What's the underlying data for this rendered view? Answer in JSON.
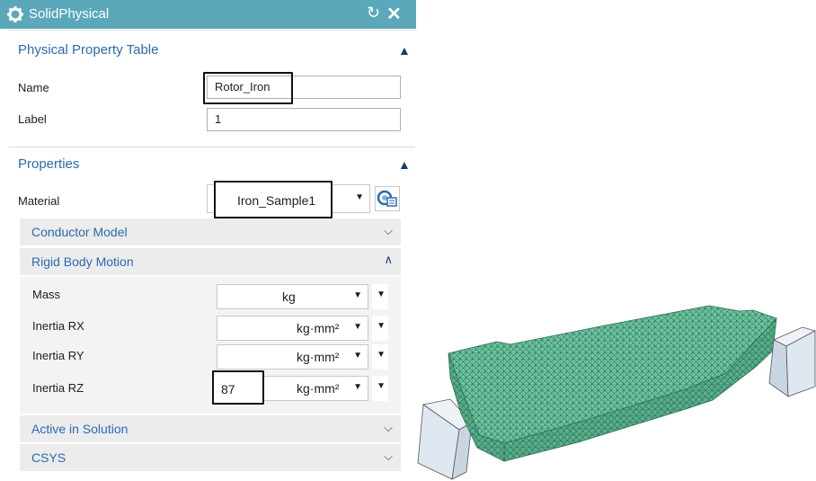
{
  "window": {
    "title": "SolidPhysical",
    "reset_glyph": "↻",
    "close_glyph": "✕"
  },
  "colors": {
    "titlebar": "#5aa8b9",
    "section_header": "#2a6ab0",
    "mesh": "#6fc9a4"
  },
  "physical_property_table": {
    "header": "Physical Property Table",
    "name_label": "Name",
    "name_value": "Rotor_Iron",
    "label_label": "Label",
    "label_value": "1"
  },
  "properties": {
    "header": "Properties",
    "material_label": "Material",
    "material_value": "Iron_Sample1",
    "conductor_model": "Conductor Model",
    "rigid_body_motion": {
      "header": "Rigid Body Motion",
      "rows": [
        {
          "label": "Mass",
          "value": "",
          "unit": "kg"
        },
        {
          "label": "Inertia RX",
          "value": "",
          "unit": "kg·mm²"
        },
        {
          "label": "Inertia RY",
          "value": "",
          "unit": "kg·mm²"
        },
        {
          "label": "Inertia RZ",
          "value": "87",
          "unit": "kg·mm²"
        }
      ]
    },
    "active_in_solution": "Active in Solution",
    "csys": "CSYS"
  },
  "icons": {
    "title": "gear-icon",
    "material_browser": "material-library-icon",
    "collapse": "chevron-up-icon",
    "expand": "chevron-down-icon"
  }
}
